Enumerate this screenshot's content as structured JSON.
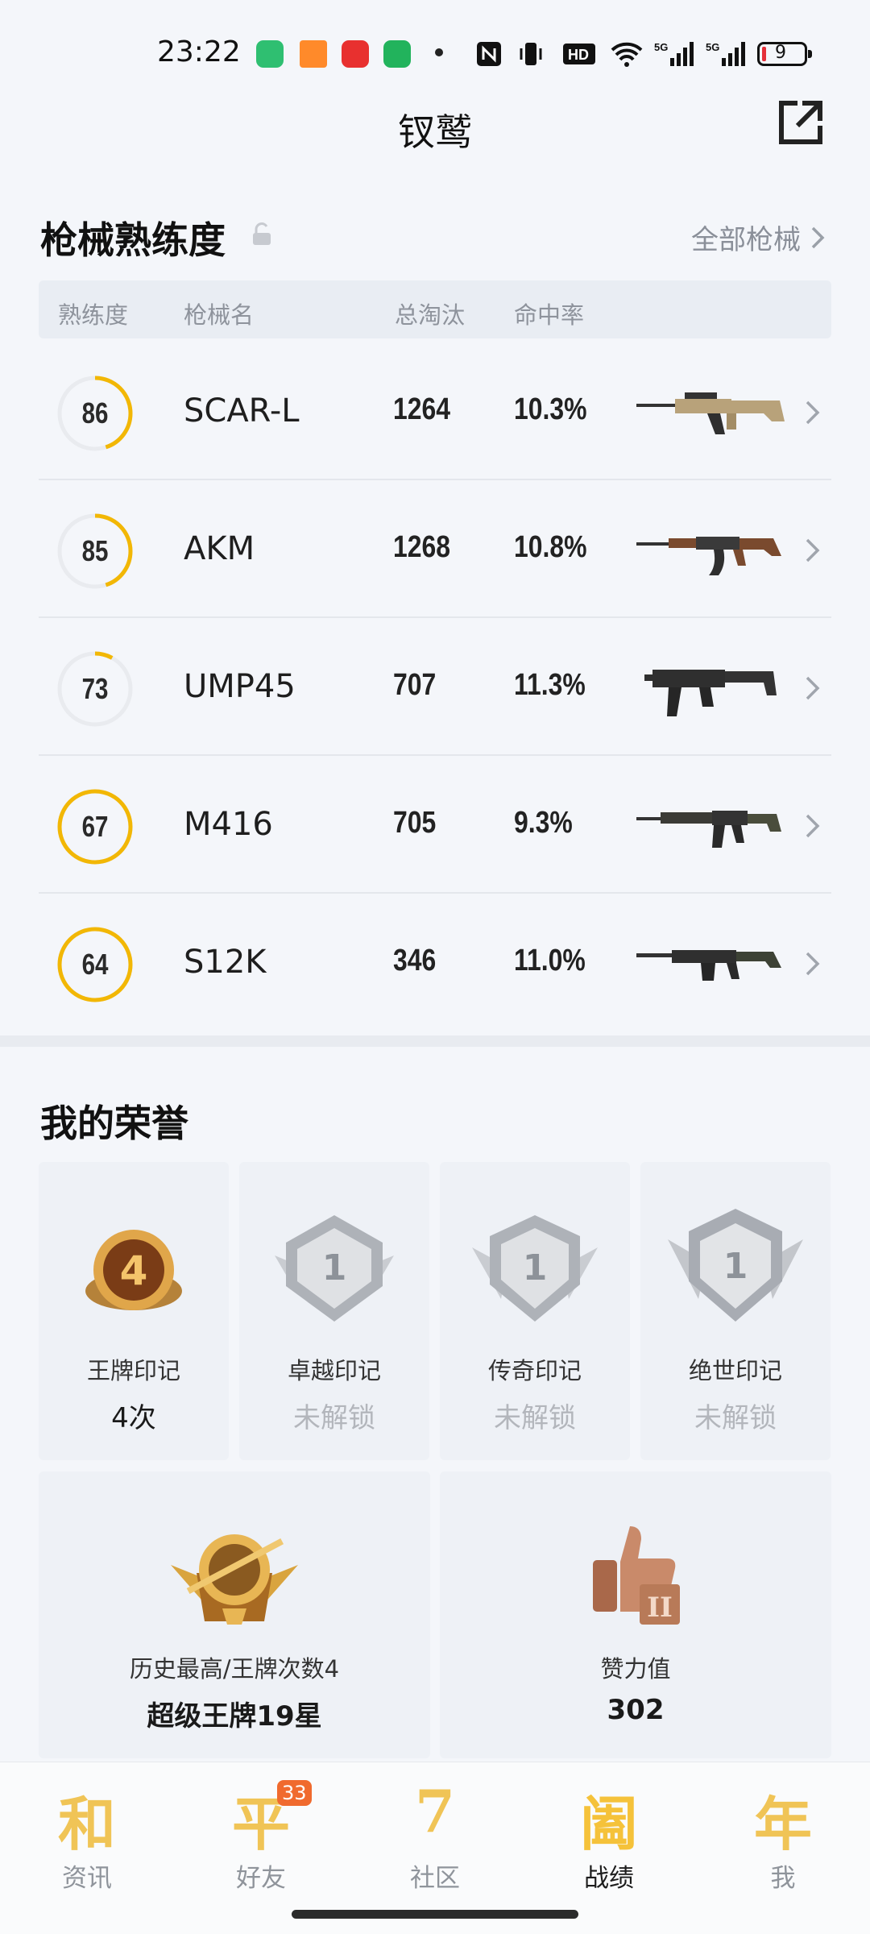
{
  "status_bar": {
    "time": "23:22",
    "battery": "9"
  },
  "header": {
    "title": "钗鹫",
    "share_icon": "share-external-icon"
  },
  "gun_section": {
    "title": "枪械熟练度",
    "all_link": "全部枪械",
    "columns": {
      "proficiency": "熟练度",
      "name": "枪械名",
      "kills": "总淘汰",
      "hit_rate": "命中率"
    },
    "rows": [
      {
        "proficiency": 86,
        "name": "SCAR-L",
        "kills": "1264",
        "hit_rate": "10.3%"
      },
      {
        "proficiency": 85,
        "name": "AKM",
        "kills": "1268",
        "hit_rate": "10.8%"
      },
      {
        "proficiency": 73,
        "name": "UMP45",
        "kills": "707",
        "hit_rate": "11.3%"
      },
      {
        "proficiency": 67,
        "name": "M416",
        "kills": "705",
        "hit_rate": "9.3%"
      },
      {
        "proficiency": 64,
        "name": "S12K",
        "kills": "346",
        "hit_rate": "11.0%"
      }
    ],
    "ring_progress": [
      0.45,
      0.45,
      0.08,
      1.0,
      1.0
    ],
    "ring_color": "#f2b705"
  },
  "honor_section": {
    "title": "我的荣誉",
    "badges": [
      {
        "label": "王牌印记",
        "value": "4次",
        "badge_number": "4",
        "locked": false
      },
      {
        "label": "卓越印记",
        "value": "未解锁",
        "badge_number": "1",
        "locked": true
      },
      {
        "label": "传奇印记",
        "value": "未解锁",
        "badge_number": "1",
        "locked": true
      },
      {
        "label": "绝世印记",
        "value": "未解锁",
        "badge_number": "1",
        "locked": true
      }
    ],
    "rank": {
      "label": "历史最高/王牌次数4",
      "value": "超级王牌19星"
    },
    "likes": {
      "label": "赞力值",
      "value": "302"
    }
  },
  "bottom_nav": {
    "items": [
      {
        "glyph": "和",
        "label": "资讯"
      },
      {
        "glyph": "平",
        "label": "好友",
        "badge": "33"
      },
      {
        "glyph": "7",
        "label": "社区"
      },
      {
        "glyph": "阖",
        "label": "战绩",
        "active": true
      },
      {
        "glyph": "年",
        "label": "我"
      }
    ]
  }
}
